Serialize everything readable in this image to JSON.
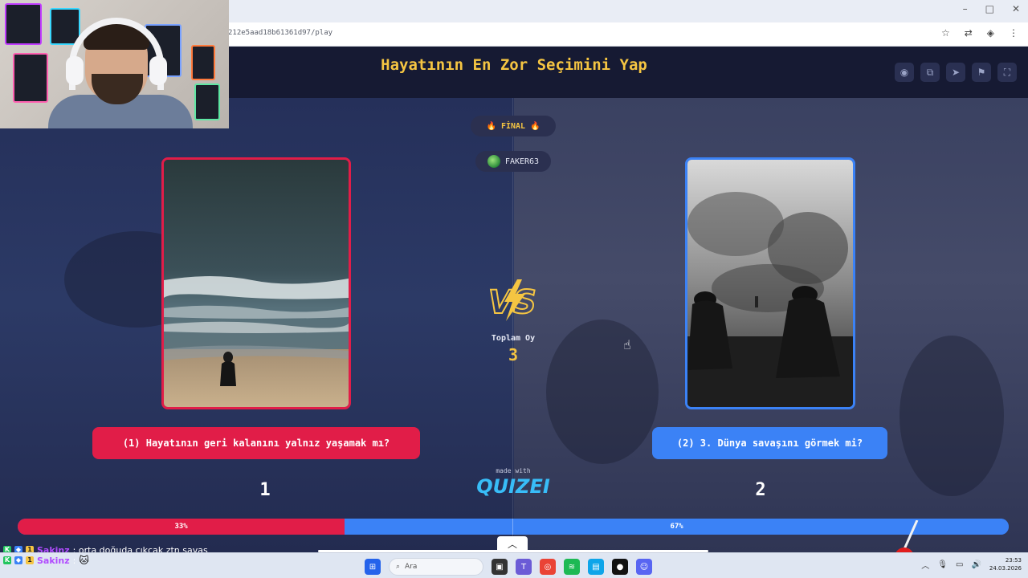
{
  "browser": {
    "url": "212e5aad18b61361d97/play",
    "window_controls": [
      "–",
      "□",
      "✕"
    ]
  },
  "quiz": {
    "title": "Hayatının En Zor Seçimini Yap",
    "round_label": "FİNAL",
    "username": "FAKER63",
    "total_votes_label": "Toplam Oy",
    "total_votes": "3",
    "left_option": {
      "text": "(1) Hayatının geri kalanını yalnız yaşamak mı?",
      "number": "1",
      "percent_label": "33%",
      "percent": 0.33
    },
    "right_option": {
      "text": "(2) 3. Dünya savaşını görmek mi?",
      "number": "2",
      "percent_label": "67%",
      "percent": 0.67
    },
    "made_with": "made with",
    "brand": "QUIZEI",
    "colors": {
      "accent": "#f5c542",
      "left": "#e11d48",
      "right": "#3b82f6",
      "brand": "#38bdf8"
    }
  },
  "header_tools": [
    "eye-icon",
    "share-icon",
    "send-icon",
    "flag-icon",
    "fullscreen-icon"
  ],
  "chat": [
    {
      "user": "Sakinz",
      "message": ": orta doğuda çıkcak ztn savaş"
    },
    {
      "user": "Sakinz",
      "message": ":"
    }
  ],
  "taskbar": {
    "search_placeholder": "Ara",
    "time": "23:53",
    "date": "24.03.2026"
  }
}
